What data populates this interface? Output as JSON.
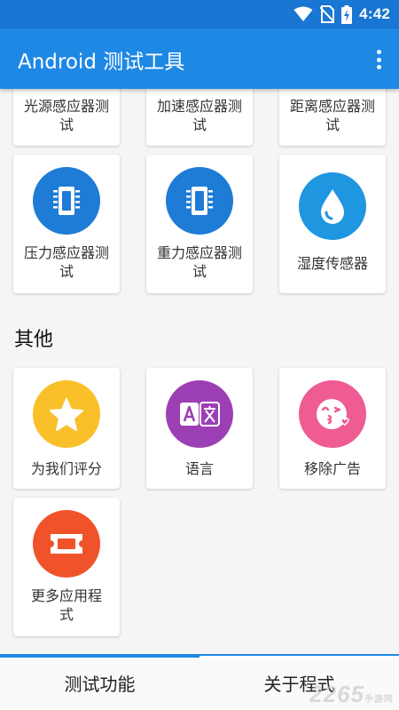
{
  "status_bar": {
    "time": "4:42",
    "icons": [
      "wifi-icon",
      "no-sim-icon",
      "battery-charging-icon"
    ]
  },
  "app_bar": {
    "title": "Android 测试工具",
    "menu_icon": "more-vert-icon"
  },
  "sensor_cards": [
    {
      "label": "光源感应器测试"
    },
    {
      "label": "加速感应器测试"
    },
    {
      "label": "距离感应器测试"
    },
    {
      "label": "压力感应器测试",
      "icon": "chip-icon",
      "color": "#1e7bd6"
    },
    {
      "label": "重力感应器测试",
      "icon": "chip-icon",
      "color": "#1e7bd6"
    },
    {
      "label": "湿度传感器",
      "icon": "water-drop-icon",
      "color": "#1e96e0"
    }
  ],
  "other_section": {
    "title": "其他",
    "cards": [
      {
        "label": "为我们评分",
        "icon": "star-icon",
        "color": "#f9c02a"
      },
      {
        "label": "语言",
        "icon": "translate-icon",
        "color": "#9c3fb5"
      },
      {
        "label": "移除广告",
        "icon": "kiss-face-icon",
        "color": "#ef5b93"
      },
      {
        "label": "更多应用程式",
        "icon": "ticket-icon",
        "color": "#f0532a"
      }
    ]
  },
  "bottom_nav": {
    "tabs": [
      {
        "label": "测试功能",
        "active": true
      },
      {
        "label": "关于程式",
        "active": false
      }
    ]
  },
  "watermark": {
    "text": "2265",
    "sub": "手游网"
  }
}
